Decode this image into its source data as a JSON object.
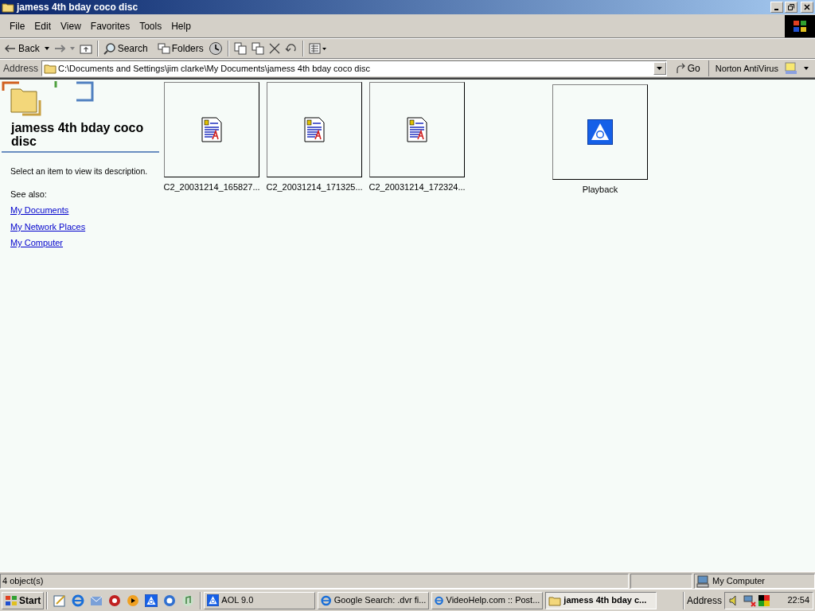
{
  "window": {
    "title": "jamess 4th bday coco disc"
  },
  "menu": [
    "File",
    "Edit",
    "View",
    "Favorites",
    "Tools",
    "Help"
  ],
  "toolbar": {
    "back": "Back",
    "search": "Search",
    "folders": "Folders"
  },
  "address_bar": {
    "label": "Address",
    "value": "C:\\Documents and Settings\\jim clarke\\My Documents\\jamess 4th bday coco disc",
    "go": "Go",
    "norton": "Norton AntiVirus"
  },
  "sidebar": {
    "title": "jamess 4th bday coco disc",
    "description": "Select an item to view its description.",
    "see_also": "See also:",
    "links": [
      "My Documents",
      "My Network Places",
      "My Computer"
    ]
  },
  "files": [
    {
      "name": "C2_20031214_165827...",
      "kind": "document"
    },
    {
      "name": "C2_20031214_171325...",
      "kind": "document"
    },
    {
      "name": "C2_20031214_172324...",
      "kind": "document"
    },
    {
      "name": "Playback",
      "kind": "app"
    }
  ],
  "status_bar": {
    "count": "4 object(s)",
    "location": "My Computer"
  },
  "taskbar": {
    "start": "Start",
    "buttons": [
      {
        "label": "AOL 9.0",
        "kind": "aol",
        "selected": false
      },
      {
        "label": "Google Search: .dvr fi...",
        "kind": "ie",
        "selected": false
      },
      {
        "label": "VideoHelp.com :: Post...",
        "kind": "ie",
        "selected": false
      },
      {
        "label": "jamess 4th bday c...",
        "kind": "folder",
        "selected": true
      }
    ],
    "address": "Address",
    "clock": "22:54"
  }
}
